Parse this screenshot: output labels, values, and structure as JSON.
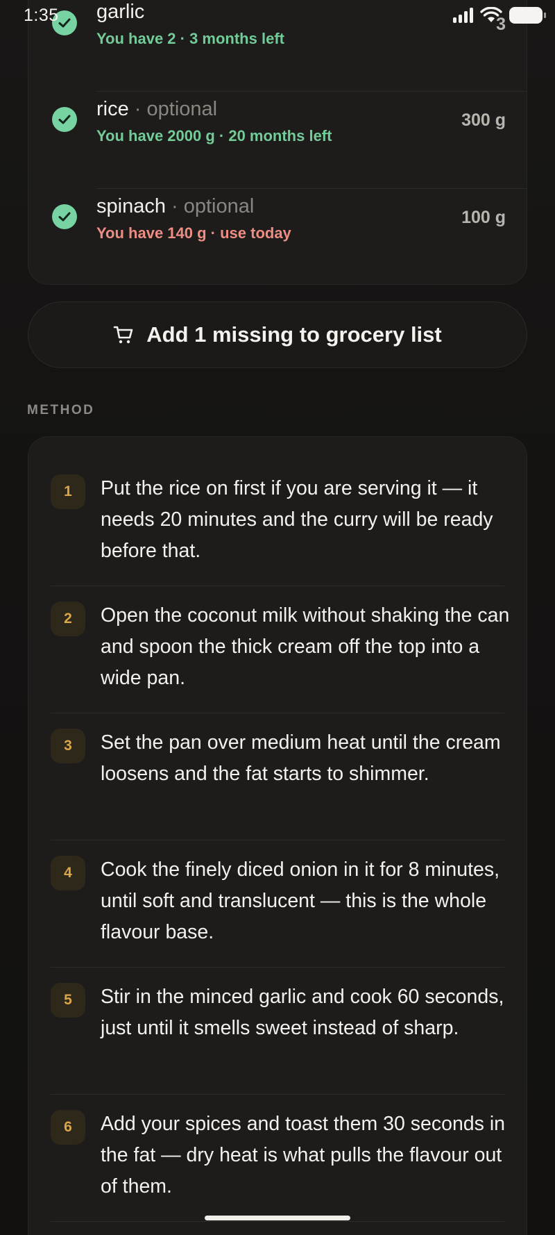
{
  "status_bar": {
    "time": "1:35"
  },
  "ingredients": [
    {
      "name": "garlic",
      "optional_label": "",
      "status": "You have 2 · 3 months left",
      "status_tone": "green",
      "quantity": "3"
    },
    {
      "name": "rice",
      "optional_label": " · optional",
      "status": "You have 2000 g · 20 months left",
      "status_tone": "green",
      "quantity": "300 g"
    },
    {
      "name": "spinach",
      "optional_label": " · optional",
      "status": "You have 140 g · use today",
      "status_tone": "red",
      "quantity": "100 g"
    }
  ],
  "grocery_button": {
    "label": "Add 1 missing to grocery list",
    "icon": "cart-icon"
  },
  "method": {
    "heading": "METHOD",
    "steps": [
      {
        "number": "1",
        "text": "Put the rice on first if you are serving it — it needs 20 minutes and the curry will be ready before that."
      },
      {
        "number": "2",
        "text": "Open the coconut milk without shaking the can and spoon the thick cream off the top into a wide pan."
      },
      {
        "number": "3",
        "text": "Set the pan over medium heat until the cream loosens and the fat starts to shimmer."
      },
      {
        "number": "4",
        "text": "Cook the finely diced onion in it for 8 minutes, until soft and translucent — this is the whole flavour base."
      },
      {
        "number": "5",
        "text": "Stir in the minced garlic and cook 60 seconds, just until it smells sweet instead of sharp."
      },
      {
        "number": "6",
        "text": "Add your spices and toast them 30 seconds in the fat — dry heat is what pulls the flavour out of them."
      }
    ]
  },
  "colors": {
    "check_green": "#78d3a2",
    "status_green": "#73cc98",
    "status_red": "#ee8d84",
    "step_accent": "#dba54a"
  }
}
